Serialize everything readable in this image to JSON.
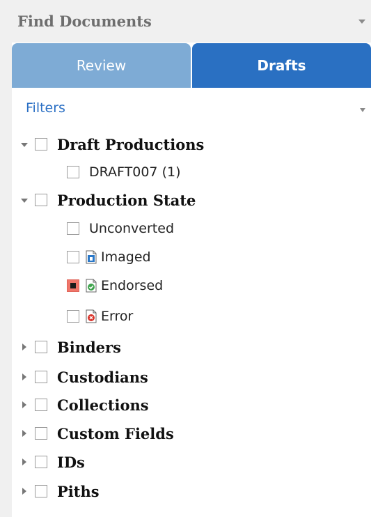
{
  "header": {
    "title": "Find Documents"
  },
  "tabs": [
    {
      "label": "Review",
      "active": false
    },
    {
      "label": "Drafts",
      "active": true
    }
  ],
  "filters": {
    "label": "Filters"
  },
  "tree": {
    "draft_productions": {
      "label": "Draft Productions",
      "children": [
        {
          "label": "DRAFT007 (1)"
        }
      ]
    },
    "production_state": {
      "label": "Production State",
      "children": [
        {
          "label": "Unconverted",
          "icon": "none"
        },
        {
          "label": "Imaged",
          "icon": "imaged-doc-icon"
        },
        {
          "label": "Endorsed",
          "icon": "endorsed-doc-icon",
          "checked": true
        },
        {
          "label": "Error",
          "icon": "error-doc-icon"
        }
      ]
    },
    "collapsed": [
      {
        "label": "Binders"
      },
      {
        "label": "Custodians"
      },
      {
        "label": "Collections"
      },
      {
        "label": "Custom Fields"
      },
      {
        "label": "IDs"
      },
      {
        "label": "Piths"
      }
    ]
  },
  "colors": {
    "tab_active": "#2a70c2",
    "tab_inactive": "#7eabd5",
    "link": "#2a6fc4",
    "checked": "#f0766a"
  }
}
